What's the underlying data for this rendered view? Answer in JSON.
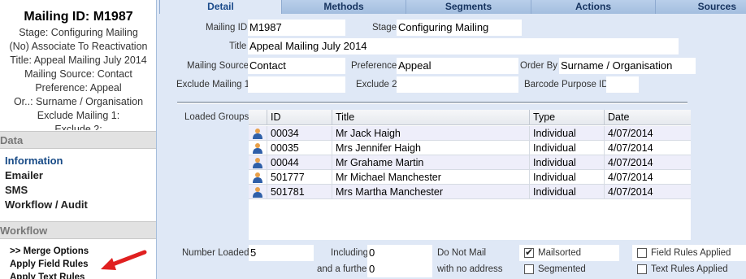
{
  "sidebar": {
    "title": "Mailing ID: M1987",
    "summary": [
      "Stage: Configuring Mailing",
      "(No) Associate To Reactivation",
      "Title: Appeal Mailing July 2014",
      "Mailing Source: Contact",
      "Preference: Appeal",
      "Or..: Surname / Organisation",
      "Exclude Mailing 1:",
      "Exclude 2:"
    ],
    "data_header": "Data",
    "data_items": [
      "Information",
      "Emailer",
      "SMS",
      "Workflow / Audit"
    ],
    "workflow_header": "Workflow",
    "workflow_items": [
      ">> Merge Options",
      "Apply Field Rules",
      "Apply Text Rules"
    ]
  },
  "tabs": [
    "Detail",
    "Methods",
    "Segments",
    "Actions",
    "Sources"
  ],
  "form": {
    "mailing_id_label": "Mailing ID",
    "mailing_id": "M1987",
    "stage_label": "Stage",
    "stage": "Configuring Mailing",
    "title_label": "Title",
    "title": "Appeal Mailing July 2014",
    "source_label": "Mailing Source",
    "source": "Contact",
    "preference_label": "Preference",
    "preference": "Appeal",
    "order_by_label": "Order By",
    "order_by": "Surname / Organisation",
    "exclude1_label": "Exclude Mailing 1",
    "exclude1": "",
    "exclude2_label": "Exclude 2",
    "exclude2": "",
    "barcode_label": "Barcode Purpose ID",
    "barcode": ""
  },
  "loaded_groups": {
    "label": "Loaded Groups",
    "columns": [
      "ID",
      "Title",
      "Type",
      "Date"
    ],
    "rows": [
      {
        "id": "00034",
        "title": "Mr Jack Haigh",
        "type": "Individual",
        "date": "4/07/2014"
      },
      {
        "id": "00035",
        "title": "Mrs Jennifer Haigh",
        "type": "Individual",
        "date": "4/07/2014"
      },
      {
        "id": "00044",
        "title": "Mr Grahame Martin",
        "type": "Individual",
        "date": "4/07/2014"
      },
      {
        "id": "501777",
        "title": "Mr Michael Manchester",
        "type": "Individual",
        "date": "4/07/2014"
      },
      {
        "id": "501781",
        "title": "Mrs Martha Manchester",
        "type": "Individual",
        "date": "4/07/2014"
      }
    ]
  },
  "bottom": {
    "number_loaded_label": "Number Loaded",
    "number_loaded": "5",
    "including_label": "Including",
    "including": "0",
    "and_further_label": "and a further",
    "and_further": "0",
    "do_not_mail_label": "Do Not Mail",
    "no_address_label": "with no address",
    "mailsorted_label": "Mailsorted",
    "mailsorted": true,
    "segmented_label": "Segmented",
    "segmented": false,
    "field_rules_label": "Field Rules Applied",
    "field_rules": false,
    "text_rules_label": "Text Rules Applied",
    "text_rules": false
  },
  "colors": {
    "arrow": "#e02020",
    "person_icon_body": "#2f5fa8",
    "person_icon_head": "#e8a04a"
  },
  "icons": {
    "row_icon": "person-icon",
    "pointer": "red-arrow-icon"
  }
}
